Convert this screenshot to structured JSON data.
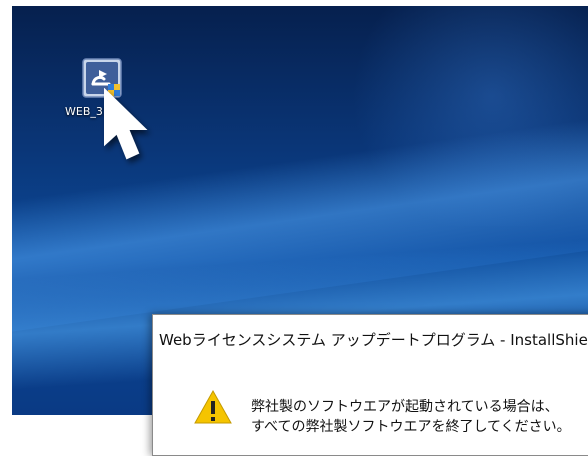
{
  "desktop": {
    "icon_label": "WEB_31"
  },
  "dialog": {
    "title": "Webライセンスシステム アップデートプログラム - InstallShie",
    "message_line1": "弊社製のソフトウエアが起動されている場合は、",
    "message_line2": "すべての弊社製ソフトウエアを終了してください。"
  },
  "colors": {
    "desktop_dark": "#06204e",
    "desktop_light": "#1e7be0",
    "warning_yellow": "#f5c400"
  },
  "icons": [
    "installer-icon",
    "mouse-cursor-icon",
    "warning-icon"
  ]
}
